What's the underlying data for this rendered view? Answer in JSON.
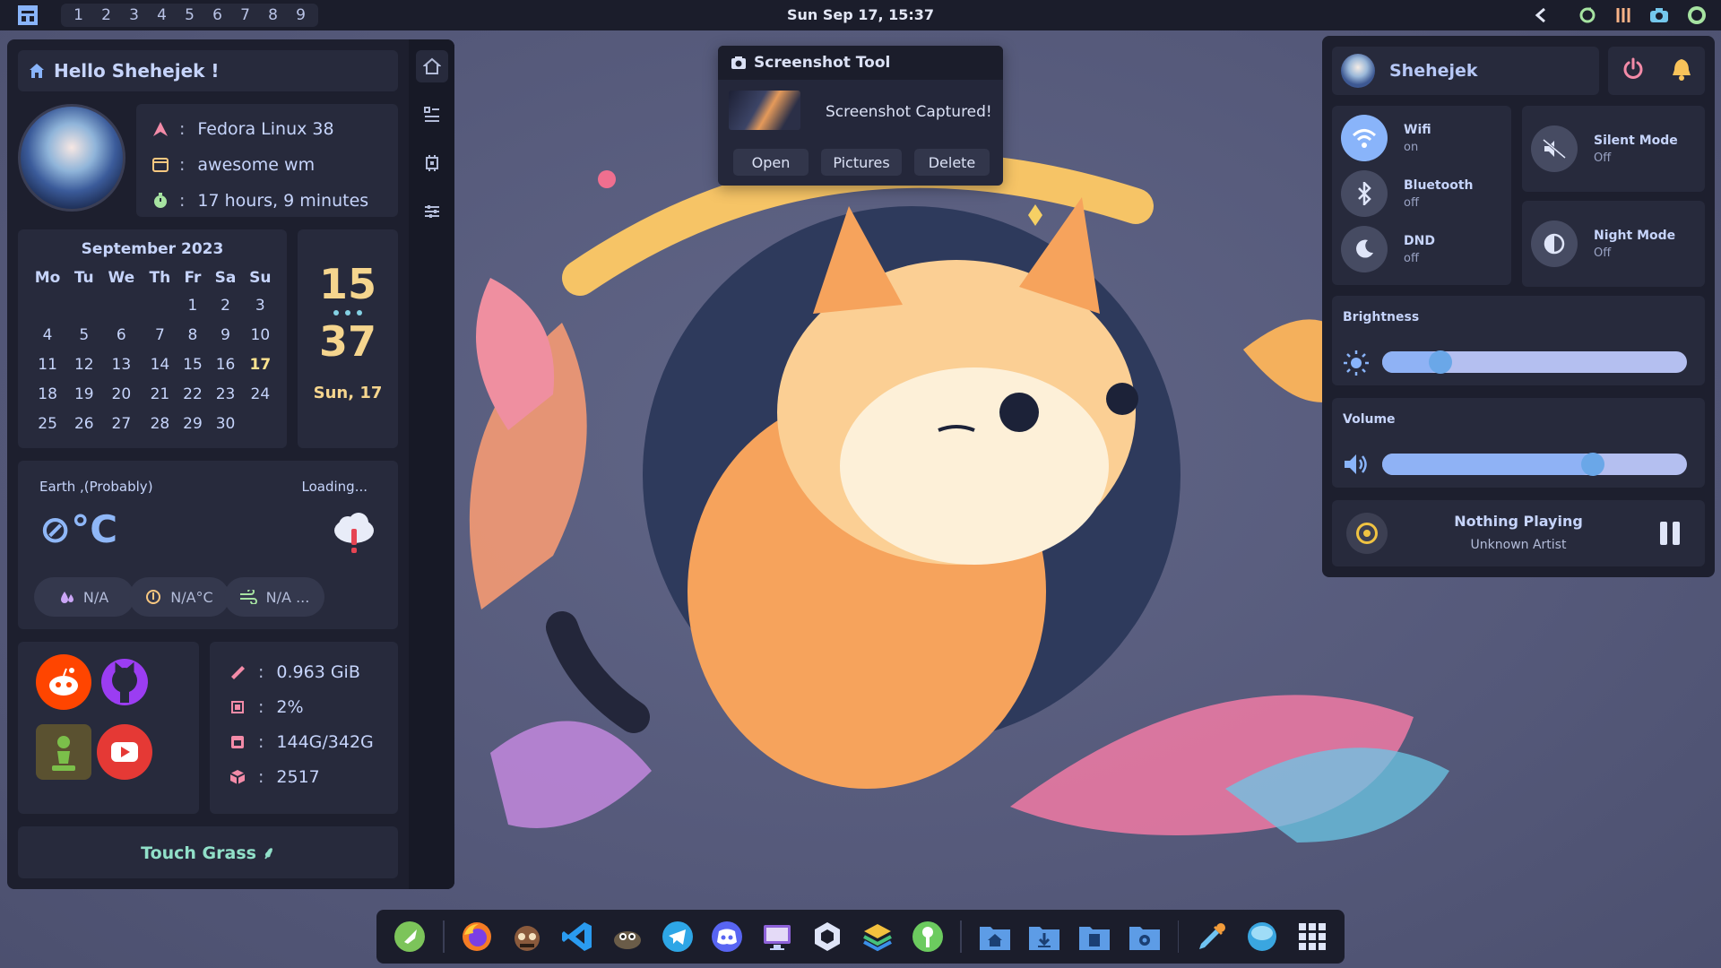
{
  "topbar": {
    "workspaces": [
      "1",
      "2",
      "3",
      "4",
      "5",
      "6",
      "7",
      "8",
      "9"
    ],
    "clock": "Sun Sep 17, 15:37",
    "tray_icons": [
      "chevron-left-icon",
      "refresh-icon",
      "equalizer-icon",
      "camera-icon",
      "battery-icon"
    ]
  },
  "dashboard": {
    "greeting": "Hello Shehejek !",
    "sysinfo": [
      {
        "icon": "fedora-arrow-icon",
        "sep": ":",
        "value": "Fedora Linux 38"
      },
      {
        "icon": "window-icon",
        "sep": ":",
        "value": "awesome wm"
      },
      {
        "icon": "stopwatch-icon",
        "sep": ":",
        "value": "17 hours, 9 minutes"
      }
    ],
    "calendar": {
      "title": "September 2023",
      "weekdays": [
        "Mo",
        "Tu",
        "We",
        "Th",
        "Fr",
        "Sa",
        "Su"
      ],
      "weeks": [
        [
          "",
          "",
          "",
          "",
          "1",
          "2",
          "3"
        ],
        [
          "4",
          "5",
          "6",
          "7",
          "8",
          "9",
          "10"
        ],
        [
          "11",
          "12",
          "13",
          "14",
          "15",
          "16",
          "17"
        ],
        [
          "18",
          "19",
          "20",
          "21",
          "22",
          "23",
          "24"
        ],
        [
          "25",
          "26",
          "27",
          "28",
          "29",
          "30",
          ""
        ]
      ],
      "today": "17"
    },
    "clock": {
      "hour": "15",
      "minute": "37",
      "date": "Sun, 17"
    },
    "weather": {
      "location": "Earth ,(Probably)",
      "status": "Loading...",
      "temp": "⊘°C",
      "humidity": "N/A",
      "feels": "N/A°C",
      "wind": "N/A ..."
    },
    "apps": [
      "reddit",
      "github",
      "chess",
      "youtube"
    ],
    "resources": [
      {
        "icon": "ram-icon",
        "sep": ":",
        "value": "0.963 GiB"
      },
      {
        "icon": "cpu-icon",
        "sep": ":",
        "value": "2%"
      },
      {
        "icon": "disk-icon",
        "sep": ":",
        "value": "144G/342G"
      },
      {
        "icon": "package-icon",
        "sep": ":",
        "value": "2517"
      }
    ],
    "footer": "Touch Grass ⸙"
  },
  "notification": {
    "app": "Screenshot Tool",
    "message": "Screenshot Captured!",
    "actions": [
      "Open",
      "Pictures",
      "Delete"
    ]
  },
  "control_center": {
    "user": "Shehejek",
    "toggles": [
      {
        "name": "Wifi",
        "state": "on",
        "active": true
      },
      {
        "name": "Bluetooth",
        "state": "off",
        "active": false
      },
      {
        "name": "DND",
        "state": "off",
        "active": false
      }
    ],
    "modes": [
      {
        "name": "Silent Mode",
        "state": "Off"
      },
      {
        "name": "Night Mode",
        "state": "Off"
      }
    ],
    "brightness": {
      "label": "Brightness",
      "level": 0.19
    },
    "volume": {
      "label": "Volume",
      "level": 0.69
    },
    "media": {
      "title": "Nothing Playing",
      "artist": "Unknown Artist"
    }
  },
  "dock": {
    "apps": [
      "rocket",
      "firefox",
      "terminal",
      "vscode",
      "gimp",
      "telegram",
      "discord",
      "monitor",
      "unity",
      "stack",
      "keepass",
      "home-folder",
      "downloads-folder",
      "documents-folder",
      "settings-folder",
      "color-picker",
      "weather",
      "app-grid"
    ]
  }
}
